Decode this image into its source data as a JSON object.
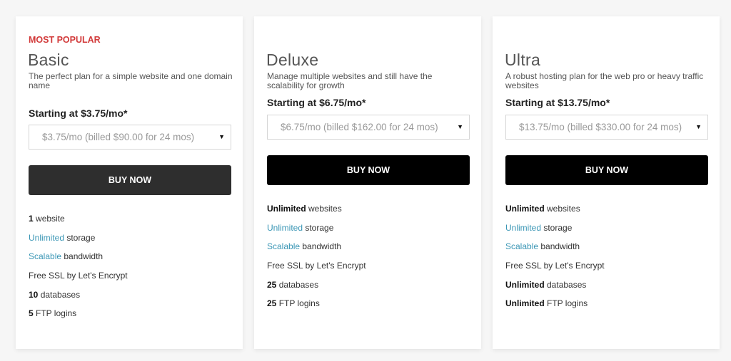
{
  "colors": {
    "badge": "#d23a3a",
    "link": "#3a96b5",
    "buy_popular": "#2e2e2e",
    "buy_regular": "#000000"
  },
  "plans": [
    {
      "badge": "MOST POPULAR",
      "name": "Basic",
      "description": "The perfect plan for a simple website and one domain name",
      "starting": "Starting at $3.75/mo*",
      "term_select": "$3.75/mo (billed $90.00 for 24 mos)",
      "buy_label": "BUY NOW",
      "features": [
        {
          "highlight": "1",
          "style": "bold",
          "text": " website"
        },
        {
          "highlight": "Unlimited",
          "style": "link",
          "text": " storage"
        },
        {
          "highlight": "Scalable",
          "style": "link",
          "text": " bandwidth"
        },
        {
          "highlight": "",
          "style": "plain",
          "text": "Free SSL by Let's Encrypt"
        },
        {
          "highlight": "10",
          "style": "bold",
          "text": " databases"
        },
        {
          "highlight": "5",
          "style": "bold",
          "text": " FTP logins"
        }
      ]
    },
    {
      "badge": "",
      "name": "Deluxe",
      "description": "Manage multiple websites and still have the scalability for growth",
      "starting": "Starting at $6.75/mo*",
      "term_select": "$6.75/mo (billed $162.00 for 24 mos)",
      "buy_label": "BUY NOW",
      "features": [
        {
          "highlight": "Unlimited",
          "style": "bold",
          "text": " websites"
        },
        {
          "highlight": "Unlimited",
          "style": "link",
          "text": " storage"
        },
        {
          "highlight": "Scalable",
          "style": "link",
          "text": " bandwidth"
        },
        {
          "highlight": "",
          "style": "plain",
          "text": "Free SSL by Let's Encrypt"
        },
        {
          "highlight": "25",
          "style": "bold",
          "text": " databases"
        },
        {
          "highlight": "25",
          "style": "bold",
          "text": " FTP logins"
        }
      ]
    },
    {
      "badge": "",
      "name": "Ultra",
      "description": "A robust hosting plan for the web pro or heavy traffic websites",
      "starting": "Starting at $13.75/mo*",
      "term_select": "$13.75/mo (billed $330.00 for 24 mos)",
      "buy_label": "BUY NOW",
      "features": [
        {
          "highlight": "Unlimited",
          "style": "bold",
          "text": " websites"
        },
        {
          "highlight": "Unlimited",
          "style": "link",
          "text": " storage"
        },
        {
          "highlight": "Scalable",
          "style": "link",
          "text": " bandwidth"
        },
        {
          "highlight": "",
          "style": "plain",
          "text": "Free SSL by Let's Encrypt"
        },
        {
          "highlight": "Unlimited",
          "style": "bold",
          "text": " databases"
        },
        {
          "highlight": "Unlimited",
          "style": "bold",
          "text": " FTP logins"
        }
      ]
    }
  ],
  "icons": {
    "dropdown_arrow": "▼"
  }
}
